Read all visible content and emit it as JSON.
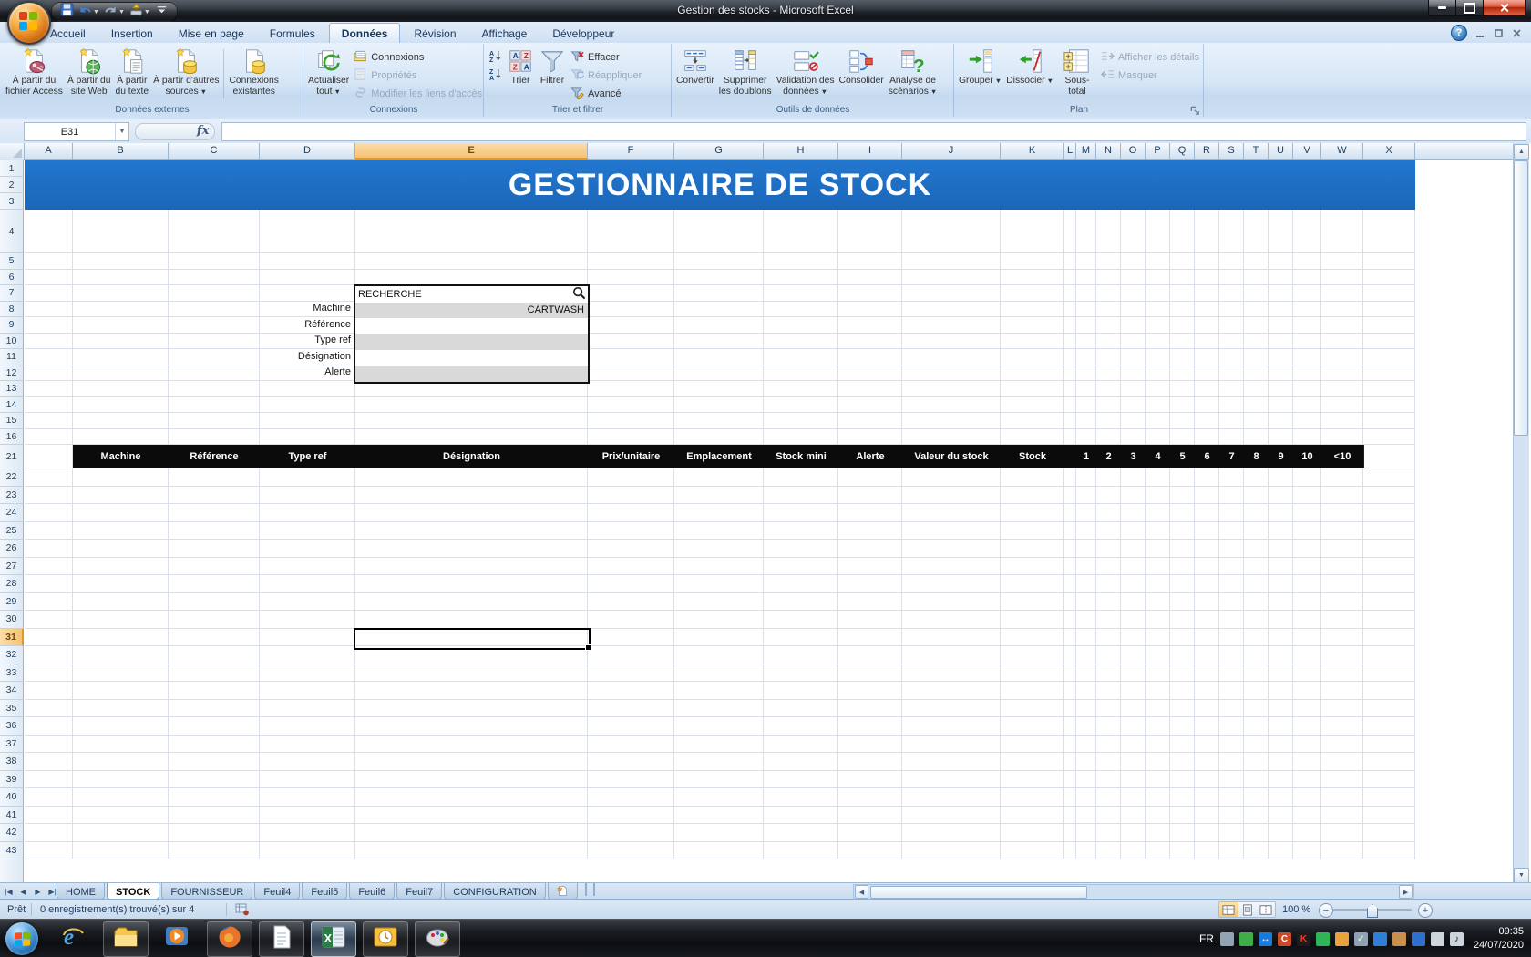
{
  "window": {
    "title": "Gestion des stocks  -  Microsoft Excel"
  },
  "qat": {
    "buttons": [
      {
        "name": "save-button",
        "icon": "save-icon"
      },
      {
        "name": "undo-button",
        "icon": "undo-icon",
        "dropdown": true
      },
      {
        "name": "redo-button",
        "icon": "redo-icon",
        "dropdown": true
      },
      {
        "name": "quick-tool-button",
        "icon": "quick-tool-icon",
        "dropdown": true
      },
      {
        "name": "customize-qat-button",
        "icon": "qat-overflow-icon"
      }
    ]
  },
  "ribbon": {
    "tabs": [
      {
        "label": "Accueil"
      },
      {
        "label": "Insertion"
      },
      {
        "label": "Mise en page"
      },
      {
        "label": "Formules"
      },
      {
        "label": "Données",
        "active": true
      },
      {
        "label": "Révision"
      },
      {
        "label": "Affichage"
      },
      {
        "label": "Développeur"
      }
    ],
    "groups": [
      {
        "label": "Données externes",
        "items": [
          {
            "type": "big",
            "label": "À partir du\nfichier Access",
            "icon": "access-file-icon"
          },
          {
            "type": "big",
            "label": "À partir du\nsite Web",
            "icon": "web-file-icon"
          },
          {
            "type": "big",
            "label": "À partir\ndu texte",
            "icon": "text-file-icon"
          },
          {
            "type": "big",
            "label": "À partir d'autres\nsources",
            "icon": "other-sources-icon",
            "dropdown": true
          },
          {
            "type": "sep"
          },
          {
            "type": "big",
            "label": "Connexions\nexistantes",
            "icon": "existing-connections-icon"
          }
        ]
      },
      {
        "label": "Connexions",
        "items": [
          {
            "type": "big",
            "label": "Actualiser\ntout",
            "icon": "refresh-all-icon",
            "dropdown": true
          },
          {
            "type": "stack",
            "items": [
              {
                "label": "Connexions",
                "icon": "connections-icon"
              },
              {
                "label": "Propriétés",
                "icon": "properties-icon",
                "disabled": true
              },
              {
                "label": "Modifier les liens d'accès",
                "icon": "edit-links-icon",
                "disabled": true
              }
            ]
          }
        ]
      },
      {
        "label": "Trier et filtrer",
        "items": [
          {
            "type": "stack",
            "items": [
              {
                "label": "",
                "icon": "sort-asc-icon"
              },
              {
                "label": "",
                "icon": "sort-desc-icon"
              }
            ]
          },
          {
            "type": "big",
            "label": "Trier",
            "icon": "sort-dialog-icon"
          },
          {
            "type": "big",
            "label": "Filtrer",
            "icon": "filter-icon"
          },
          {
            "type": "stack",
            "items": [
              {
                "label": "Effacer",
                "icon": "clear-filter-icon"
              },
              {
                "label": "Réappliquer",
                "icon": "reapply-filter-icon",
                "disabled": true
              },
              {
                "label": "Avancé",
                "icon": "advanced-filter-icon"
              }
            ]
          }
        ]
      },
      {
        "label": "Outils de données",
        "items": [
          {
            "type": "big",
            "label": "Convertir",
            "icon": "text-to-columns-icon"
          },
          {
            "type": "big",
            "label": "Supprimer\nles doublons",
            "icon": "remove-duplicates-icon"
          },
          {
            "type": "big",
            "label": "Validation des\ndonnées",
            "icon": "data-validation-icon",
            "dropdown": true
          },
          {
            "type": "big",
            "label": "Consolider",
            "icon": "consolidate-icon"
          },
          {
            "type": "big",
            "label": "Analyse de\nscénarios",
            "icon": "what-if-analysis-icon",
            "dropdown": true
          }
        ]
      },
      {
        "label": "Plan",
        "dialog_launcher": true,
        "items": [
          {
            "type": "big",
            "label": "Grouper",
            "icon": "group-icon",
            "dropdown": true
          },
          {
            "type": "big",
            "label": "Dissocier",
            "icon": "ungroup-icon",
            "dropdown": true
          },
          {
            "type": "big",
            "label": "Sous-total",
            "icon": "subtotal-icon"
          },
          {
            "type": "stack",
            "items": [
              {
                "label": "Afficher les détails",
                "icon": "show-detail-icon",
                "disabled": true
              },
              {
                "label": "Masquer",
                "icon": "hide-detail-icon",
                "disabled": true
              }
            ]
          }
        ]
      }
    ]
  },
  "formula_bar": {
    "name_box": "E31",
    "fx_label": "fx",
    "formula_value": ""
  },
  "sheet": {
    "columns": [
      "A",
      "B",
      "C",
      "D",
      "E",
      "F",
      "G",
      "H",
      "I",
      "J",
      "K",
      "L",
      "M",
      "N",
      "O",
      "P",
      "Q",
      "R",
      "S",
      "T",
      "U",
      "V",
      "W",
      "X"
    ],
    "selected_column": "E",
    "rows": [
      1,
      2,
      3,
      4,
      5,
      6,
      7,
      8,
      9,
      10,
      11,
      12,
      13,
      14,
      15,
      16,
      21,
      22,
      23,
      24,
      25,
      26,
      27,
      28,
      29,
      30,
      31,
      32,
      33,
      34,
      35,
      36,
      37,
      38,
      39,
      40,
      41,
      42,
      43
    ],
    "selected_row": 31,
    "selected_cell": "E31",
    "banner_title": "GESTIONNAIRE DE STOCK",
    "search_panel": {
      "title": "RECHERCHE",
      "fields": [
        {
          "label": "Machine",
          "value": "CARTWASH"
        },
        {
          "label": "Référence",
          "value": ""
        },
        {
          "label": "Type ref",
          "value": ""
        },
        {
          "label": "Désignation",
          "value": ""
        },
        {
          "label": "Alerte",
          "value": ""
        }
      ]
    },
    "table_header": {
      "columns": [
        {
          "col": "B",
          "label": "Machine"
        },
        {
          "col": "C",
          "label": "Référence"
        },
        {
          "col": "D",
          "label": "Type ref"
        },
        {
          "col": "E",
          "label": "Désignation"
        },
        {
          "col": "F",
          "label": "Prix/unitaire"
        },
        {
          "col": "G",
          "label": "Emplacement"
        },
        {
          "col": "H",
          "label": "Stock mini"
        },
        {
          "col": "I",
          "label": "Alerte"
        },
        {
          "col": "J",
          "label": "Valeur du stock"
        },
        {
          "col": "K",
          "label": "Stock"
        },
        {
          "col": "L",
          "label": ""
        },
        {
          "col": "M",
          "label": "1"
        },
        {
          "col": "N",
          "label": "2"
        },
        {
          "col": "O",
          "label": "3"
        },
        {
          "col": "P",
          "label": "4"
        },
        {
          "col": "Q",
          "label": "5"
        },
        {
          "col": "R",
          "label": "6"
        },
        {
          "col": "S",
          "label": "7"
        },
        {
          "col": "T",
          "label": "8"
        },
        {
          "col": "U",
          "label": "9"
        },
        {
          "col": "V",
          "label": "10"
        },
        {
          "col": "W",
          "label": "<10"
        }
      ]
    }
  },
  "sheet_tabs": {
    "tabs": [
      {
        "label": "HOME"
      },
      {
        "label": "STOCK",
        "active": true
      },
      {
        "label": "FOURNISSEUR"
      },
      {
        "label": "Feuil4"
      },
      {
        "label": "Feuil5"
      },
      {
        "label": "Feuil6"
      },
      {
        "label": "Feuil7"
      },
      {
        "label": "CONFIGURATION"
      }
    ]
  },
  "status_bar": {
    "mode": "Prêt",
    "info": "0 enregistrement(s) trouvé(s) sur 4",
    "zoom_level": "100 %"
  },
  "taskbar": {
    "apps": [
      "internet-explorer",
      "windows-explorer",
      "media-player",
      "firefox",
      "notepad",
      "excel",
      "outlook",
      "paint"
    ],
    "language": "FR",
    "time": "09:35",
    "date": "24/07/2020",
    "tray": [
      {
        "name": "printer-tray-icon",
        "color": "#93a5b5"
      },
      {
        "name": "sync-tray-icon",
        "color": "#3fae49"
      },
      {
        "name": "teamviewer-tray-icon",
        "color": "#1a7ad9",
        "glyph": "↔"
      },
      {
        "name": "ccleaner-tray-icon",
        "color": "#c84b28",
        "glyph": "C"
      },
      {
        "name": "kaspersky-tray-icon",
        "color": "#1c1c1c",
        "glyph": "K",
        "glyph_color": "#e03c31"
      },
      {
        "name": "meter-tray-icon",
        "color": "#2fb457"
      },
      {
        "name": "security-clock-tray-icon",
        "color": "#e8a33d"
      },
      {
        "name": "printer-check-tray-icon",
        "color": "#8fa3b5",
        "glyph": "✓",
        "glyph_color": "#caf5cf"
      },
      {
        "name": "ime-tray-icon",
        "color": "#2f7fd6"
      },
      {
        "name": "cookie-tray-icon",
        "color": "#c98f4e"
      },
      {
        "name": "defender-shield-tray-icon",
        "color": "#2f6fce"
      },
      {
        "name": "network-tray-icon",
        "color": "#cdd5dd"
      },
      {
        "name": "volume-tray-icon",
        "color": "#cdd5dd",
        "glyph": "♪",
        "glyph_color": "#222"
      }
    ]
  }
}
